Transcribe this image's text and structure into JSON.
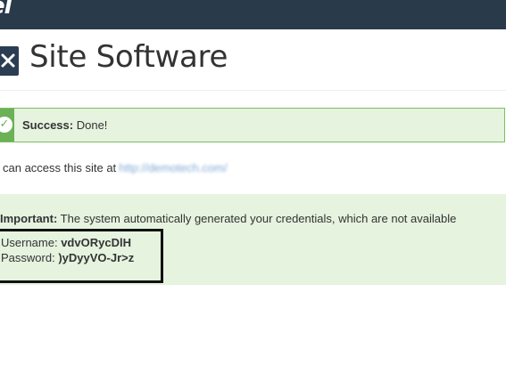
{
  "header": {
    "logo_text": "el"
  },
  "page": {
    "title": "Site Software",
    "title_icon": "puzzle-wrench-icon"
  },
  "success": {
    "label": "Success:",
    "message": "Done!",
    "icon": "checkmark-icon"
  },
  "access": {
    "text": "can access this site at",
    "url": "http://demotech.com/"
  },
  "important": {
    "label": "Important:",
    "message": "The system automatically generated your credentials, which are not available"
  },
  "credentials": {
    "username_label": "Username:",
    "username": "vdvORycDlH",
    "password_label": "Password:",
    "password": ")yDyyVO-Jr>z"
  },
  "colors": {
    "topbar": "#293a4a",
    "success_border": "#7cbf63",
    "success_bg": "#e5f3df",
    "success_icon_bg": "#6cb155",
    "link": "#7fa8d6"
  }
}
